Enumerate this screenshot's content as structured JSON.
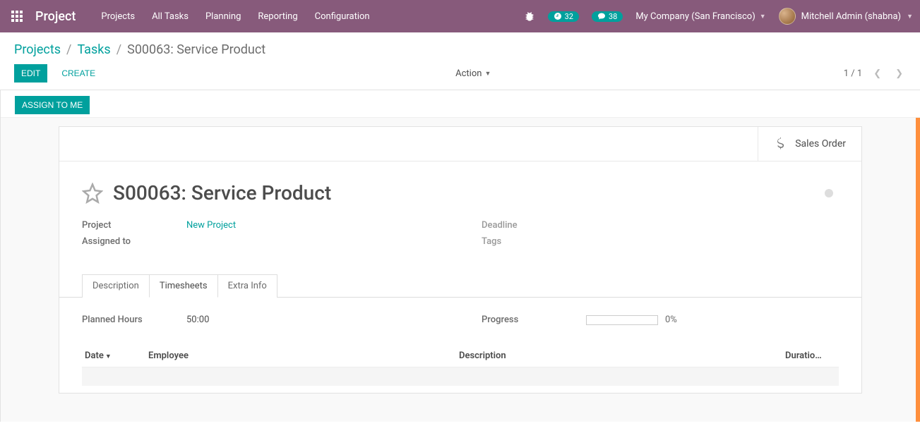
{
  "topnav": {
    "brand": "Project",
    "links": [
      "Projects",
      "All Tasks",
      "Planning",
      "Reporting",
      "Configuration"
    ],
    "timer_count": "32",
    "msg_count": "38",
    "company": "My Company (San Francisco)",
    "user": "Mitchell Admin (shabna)"
  },
  "breadcrumb": {
    "projects": "Projects",
    "tasks": "Tasks",
    "current": "S00063: Service Product"
  },
  "buttons": {
    "edit": "EDIT",
    "create": "CREATE",
    "action": "Action",
    "assign": "ASSIGN TO ME"
  },
  "pager": {
    "text": "1 / 1"
  },
  "stat": {
    "sales_order": "Sales Order"
  },
  "task": {
    "title": "S00063: Service Product",
    "fields": {
      "project_label": "Project",
      "project_value": "New Project",
      "assigned_label": "Assigned to",
      "assigned_value": "",
      "deadline_label": "Deadline",
      "deadline_value": "",
      "tags_label": "Tags",
      "tags_value": ""
    }
  },
  "tabs": {
    "description": "Description",
    "timesheets": "Timesheets",
    "extra": "Extra Info"
  },
  "timesheet": {
    "planned_label": "Planned Hours",
    "planned_value": "50:00",
    "progress_label": "Progress",
    "progress_pct": "0%",
    "columns": {
      "date": "Date",
      "employee": "Employee",
      "description": "Description",
      "duration": "Duratio…"
    }
  }
}
